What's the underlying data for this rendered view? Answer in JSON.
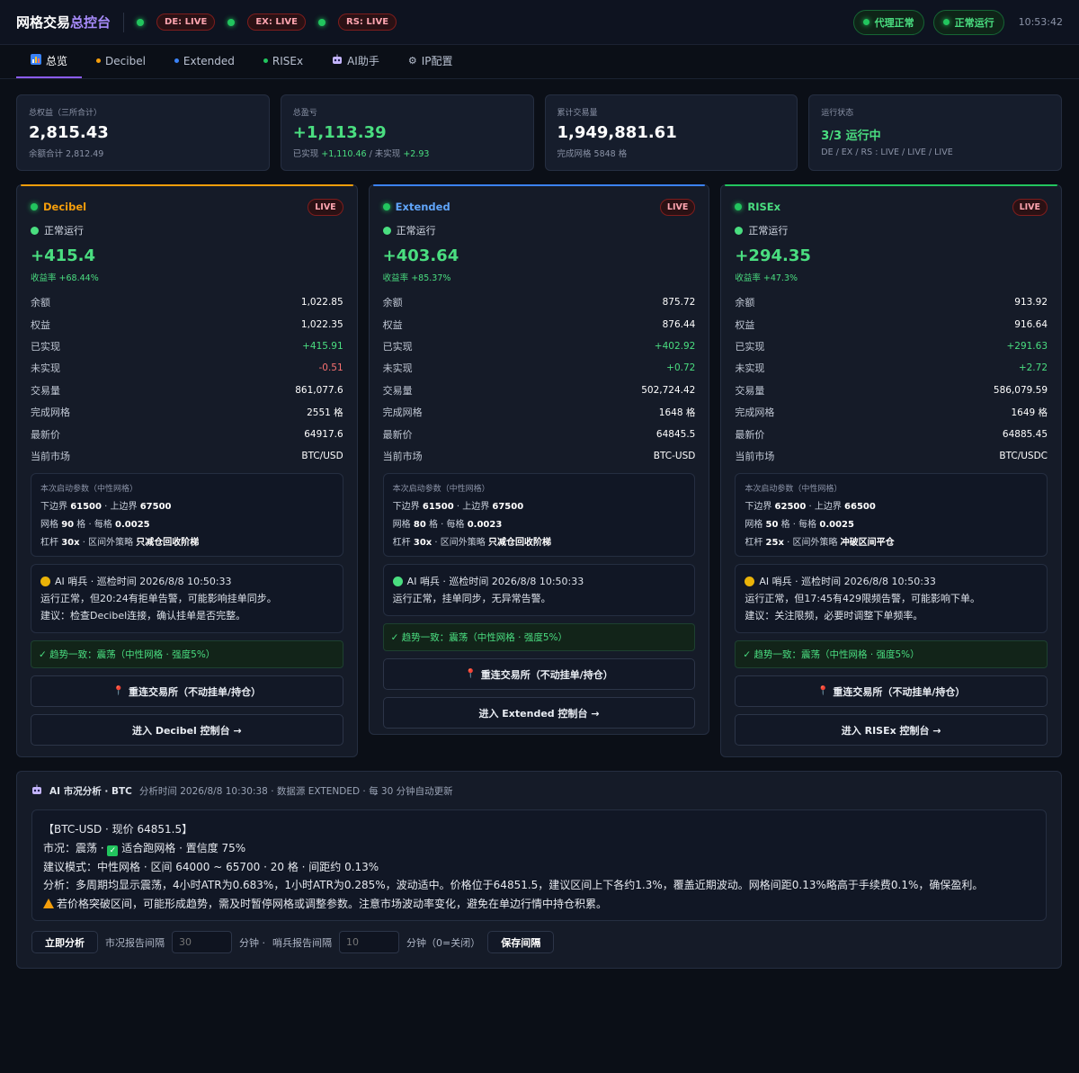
{
  "header": {
    "title_main": "网格交易",
    "title_accent": "总控台",
    "feeds": [
      {
        "label": "DE: LIVE"
      },
      {
        "label": "EX: LIVE"
      },
      {
        "label": "RS: LIVE"
      }
    ],
    "proxy_status": "代理正常",
    "run_status": "正常运行",
    "time": "10:53:42"
  },
  "tabs": [
    {
      "label": "总览",
      "icon": "bar-chart-icon",
      "active": true
    },
    {
      "label": "Decibel",
      "dot_color": "#f59e0b"
    },
    {
      "label": "Extended",
      "dot_color": "#3b82f6"
    },
    {
      "label": "RISEx",
      "dot_color": "#22c55e"
    },
    {
      "label": "AI助手",
      "icon": "robot-icon"
    },
    {
      "label": "IP配置",
      "icon": "gear-icon"
    }
  ],
  "summary": [
    {
      "label": "总权益（三所合计）",
      "value": "2,815.43",
      "sub": "余额合计 2,812.49"
    },
    {
      "label": "总盈亏",
      "value": "+1,113.39",
      "sub_a": "已实现 ",
      "sub_a_val": "+1,110.46",
      "sub_b": " / 未实现 ",
      "sub_b_val": "+2.93"
    },
    {
      "label": "累计交易量",
      "value": "1,949,881.61",
      "sub": "完成网格 5848 格"
    },
    {
      "label": "运行状态",
      "value": "3/3 运行中",
      "sub": "DE / EX / RS : LIVE / LIVE / LIVE"
    }
  ],
  "labels": {
    "live": "LIVE",
    "running": "正常运行",
    "yield_prefix": "收益率 ",
    "params_title": "本次启动参数（中性网格）",
    "lower": "下边界 ",
    "upper": " · 上边界 ",
    "grid": "网格 ",
    "grid_unit": " 格 · 每格 ",
    "leverage": "杠杆 ",
    "strategy": " · 区间外策略 ",
    "reconnect": "重连交易所（不动挂单/持仓）"
  },
  "exchanges": [
    {
      "name": "Decibel",
      "color": "#f59e0b",
      "pnl": "+415.4",
      "yield": "+68.44%",
      "stats": [
        {
          "k": "余额",
          "v": "1,022.85",
          "tone": ""
        },
        {
          "k": "权益",
          "v": "1,022.35",
          "tone": ""
        },
        {
          "k": "已实现",
          "v": "+415.91",
          "tone": "pos"
        },
        {
          "k": "未实现",
          "v": "-0.51",
          "tone": "neg"
        },
        {
          "k": "交易量",
          "v": "861,077.6",
          "tone": ""
        },
        {
          "k": "完成网格",
          "v": "2551 格",
          "tone": ""
        },
        {
          "k": "最新价",
          "v": "64917.6",
          "tone": ""
        },
        {
          "k": "当前市场",
          "v": "BTC/USD",
          "tone": ""
        }
      ],
      "params": {
        "lower": "61500",
        "upper": "67500",
        "grids": "90",
        "step": "0.0025",
        "lev": "30x",
        "strategy": "只减仓回收阶梯"
      },
      "ai": {
        "head": "AI 哨兵 · 巡检时间 2026/8/8 10:50:33",
        "line1": "运行正常，但20:24有拒单告警，可能影响挂单同步。",
        "line2": "建议：检查Decibel连接，确认挂单是否完整。",
        "dot_color": "#eab308"
      },
      "trend": "✓ 趋势一致：震荡（中性网格 · 强度5%）",
      "enter": "进入 Decibel 控制台 →"
    },
    {
      "name": "Extended",
      "color": "#3b82f6",
      "pnl": "+403.64",
      "yield": "+85.37%",
      "stats": [
        {
          "k": "余额",
          "v": "875.72",
          "tone": ""
        },
        {
          "k": "权益",
          "v": "876.44",
          "tone": ""
        },
        {
          "k": "已实现",
          "v": "+402.92",
          "tone": "pos"
        },
        {
          "k": "未实现",
          "v": "+0.72",
          "tone": "pos"
        },
        {
          "k": "交易量",
          "v": "502,724.42",
          "tone": ""
        },
        {
          "k": "完成网格",
          "v": "1648 格",
          "tone": ""
        },
        {
          "k": "最新价",
          "v": "64845.5",
          "tone": ""
        },
        {
          "k": "当前市场",
          "v": "BTC-USD",
          "tone": ""
        }
      ],
      "params": {
        "lower": "61500",
        "upper": "67500",
        "grids": "80",
        "step": "0.0023",
        "lev": "30x",
        "strategy": "只减仓回收阶梯"
      },
      "ai": {
        "head": "AI 哨兵 · 巡检时间 2026/8/8 10:50:33",
        "line1": "运行正常，挂单同步，无异常告警。",
        "line2": "",
        "dot_color": "#4ade80"
      },
      "trend": "✓ 趋势一致：震荡（中性网格 · 强度5%）",
      "enter": "进入 Extended 控制台 →"
    },
    {
      "name": "RISEx",
      "color": "#22c55e",
      "pnl": "+294.35",
      "yield": "+47.3%",
      "stats": [
        {
          "k": "余额",
          "v": "913.92",
          "tone": ""
        },
        {
          "k": "权益",
          "v": "916.64",
          "tone": ""
        },
        {
          "k": "已实现",
          "v": "+291.63",
          "tone": "pos"
        },
        {
          "k": "未实现",
          "v": "+2.72",
          "tone": "pos"
        },
        {
          "k": "交易量",
          "v": "586,079.59",
          "tone": ""
        },
        {
          "k": "完成网格",
          "v": "1649 格",
          "tone": ""
        },
        {
          "k": "最新价",
          "v": "64885.45",
          "tone": ""
        },
        {
          "k": "当前市场",
          "v": "BTC/USDC",
          "tone": ""
        }
      ],
      "params": {
        "lower": "62500",
        "upper": "66500",
        "grids": "50",
        "step": "0.0025",
        "lev": "25x",
        "strategy": "冲破区间平仓"
      },
      "ai": {
        "head": "AI 哨兵 · 巡检时间 2026/8/8 10:50:33",
        "line1": "运行正常，但17:45有429限频告警，可能影响下单。",
        "line2": "建议：关注限频，必要时调整下单频率。",
        "dot_color": "#eab308"
      },
      "trend": "✓ 趋势一致：震荡（中性网格 · 强度5%）",
      "enter": "进入 RISEx 控制台 →"
    }
  ],
  "market": {
    "title": "AI 市况分析 · BTC",
    "meta": "分析时间 2026/8/8 10:30:38 · 数据源 EXTENDED · 每 30 分钟自动更新",
    "line1": "【BTC-USD · 现价 64851.5】",
    "line2a": "市况：震荡 · ",
    "line2b": " 适合跑网格 · 置信度 75%",
    "line3": "建议模式：中性网格 · 区间 64000 ~ 65700 · 20 格 · 间距约 0.13%",
    "line4": "分析：多周期均显示震荡，4小时ATR为0.683%，1小时ATR为0.285%，波动适中。价格位于64851.5，建议区间上下各约1.3%，覆盖近期波动。网格间距0.13%略高于手续费0.1%，确保盈利。",
    "line5": "若价格突破区间，可能形成趋势，需及时暂停网格或调整参数。注意市场波动率变化，避免在单边行情中持仓积累。",
    "analyze_btn": "立即分析",
    "report_label": "市况报告间隔",
    "report_value": "30",
    "unit1": "分钟 ·",
    "sentinel_label": "哨兵报告间隔",
    "sentinel_value": "10",
    "unit2": "分钟（0=关闭）",
    "save_btn": "保存间隔"
  }
}
